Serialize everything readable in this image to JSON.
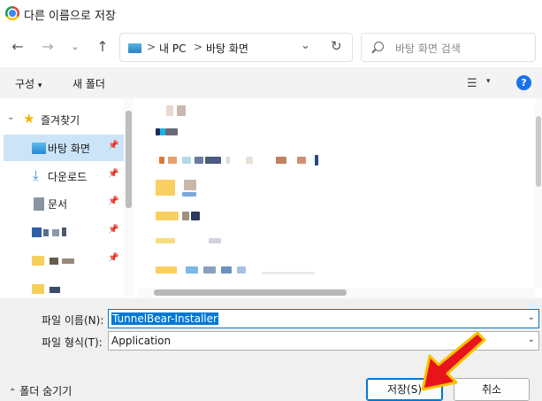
{
  "window": {
    "title": "다른 이름으로 저장"
  },
  "address": {
    "segments": [
      "내 PC",
      "바탕 화면"
    ],
    "separator": ">"
  },
  "search": {
    "placeholder": "바탕 화면 검색"
  },
  "toolbar": {
    "organize": "구성",
    "new_folder": "새 폴더"
  },
  "nav_tree": {
    "quick_access": "즐겨찾기",
    "items": [
      {
        "label": "바탕 화면",
        "icon": "desktop-icon",
        "pinned": true
      },
      {
        "label": "다운로드",
        "icon": "download-icon",
        "pinned": true
      },
      {
        "label": "문서",
        "icon": "document-icon",
        "pinned": true
      }
    ]
  },
  "form": {
    "filename_label": "파일 이름(N):",
    "filename_value": "TunnelBear-Installer",
    "filetype_label": "파일 형식(T):",
    "filetype_value": "Application"
  },
  "footer": {
    "hide_folders": "폴더 숨기기",
    "save_button": "저장(S)",
    "cancel_button": "취소"
  },
  "colors": {
    "accent": "#0078d4",
    "selection": "#cce4f7",
    "annotation_arrow": "#e8141c"
  }
}
